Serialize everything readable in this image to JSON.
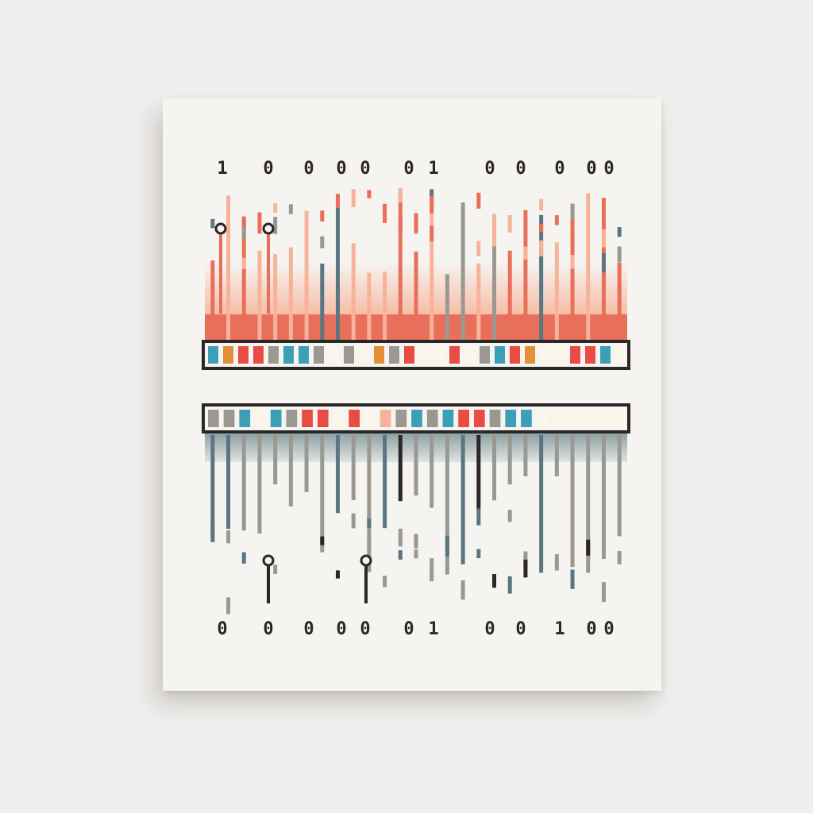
{
  "artwork": {
    "top_digits": [
      "1",
      "0",
      "0",
      "0",
      "0",
      "0",
      "1",
      "0",
      "0",
      "0",
      "0",
      "0"
    ],
    "bottom_digits": [
      "0",
      "0",
      "0",
      "0",
      "0",
      "0",
      "1",
      "0",
      "0",
      "1",
      "0",
      "0"
    ],
    "colors": {
      "ink": "#2b2628",
      "coral": "#e8705a",
      "peach": "#f6b39a",
      "teal": "#3d9fb5",
      "slate": "#5b7683",
      "gray": "#9b9892",
      "amber": "#e39038",
      "red": "#e84c44",
      "cream": "#fbf6ea",
      "canvas": "#f6f4f1",
      "wall": "#f1efed"
    },
    "top_strip_colors": [
      "teal",
      "amber",
      "red",
      "red",
      "gray",
      "teal",
      "teal",
      "gray",
      "cream",
      "gray",
      "cream",
      "amber",
      "gray",
      "red",
      "cream",
      "cream",
      "red",
      "cream",
      "gray",
      "teal",
      "red",
      "amber",
      "cream",
      "cream",
      "red",
      "red",
      "teal",
      "cream"
    ],
    "bottom_strip_colors": [
      "gray",
      "gray",
      "teal",
      "cream",
      "teal",
      "gray",
      "red",
      "red",
      "cream",
      "red",
      "cream",
      "peach",
      "gray",
      "teal",
      "gray",
      "teal",
      "red",
      "red",
      "gray",
      "teal",
      "teal",
      "cream",
      "cream",
      "cream",
      "cream",
      "cream",
      "cream"
    ]
  }
}
